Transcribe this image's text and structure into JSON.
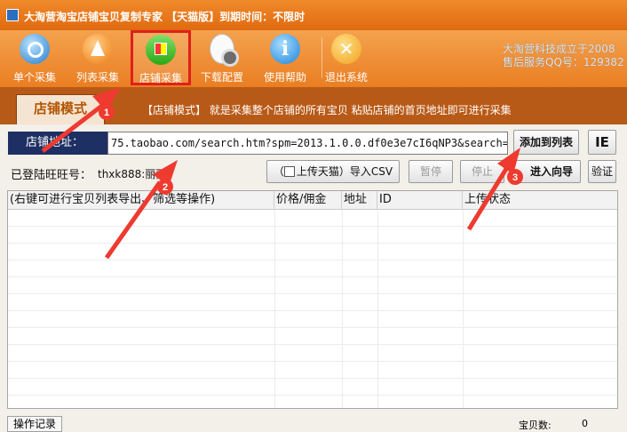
{
  "window": {
    "title": "大淘营淘宝店铺宝贝复制专家 【天猫版】到期时间：不限时"
  },
  "toolbar": {
    "buttons": [
      {
        "label": "单个采集",
        "icon": "magnifier-icon"
      },
      {
        "label": "列表采集",
        "icon": "triangle-a-icon"
      },
      {
        "label": "店铺采集",
        "icon": "shop-icon",
        "active": true
      },
      {
        "label": "下载配置",
        "icon": "document-gear-icon"
      },
      {
        "label": "使用帮助",
        "icon": "info-icon"
      },
      {
        "label": "退出系统",
        "icon": "exit-x-icon"
      }
    ]
  },
  "company": {
    "line1": "大淘营科技成立于2008",
    "line2": "售后服务QQ号：129382"
  },
  "mode": {
    "tab_label": "店铺模式",
    "description": "【店铺模式】 就是采集整个店铺的所有宝贝  粘贴店铺的首页地址即可进行采集"
  },
  "url_bar": {
    "label": "店铺地址：",
    "value": "75.taobao.com/search.htm?spm=2013.1.0.0.df0e3e7cI6qNP3&search=y",
    "add_button": "添加到列表",
    "ie_button": "IE"
  },
  "actions": {
    "login_label": "已登陆旺旺号：",
    "login_user": "thxk888:丽丽",
    "upload_tmall_label": "上传天猫",
    "upload_tmall_checked": false,
    "upload_prefix": "（",
    "upload_suffix": "）导入CSV",
    "pause": "暂停",
    "stop": "停止",
    "wizard": "进入向导",
    "verify": "验证"
  },
  "table": {
    "columns": [
      "(右键可进行宝贝列表导出、筛选等操作)",
      "价格/佣金",
      "地址",
      "ID",
      "上传状态"
    ]
  },
  "status": {
    "log_button": "操作记录",
    "count_label": "宝贝数:",
    "count": "0"
  },
  "annotations": {
    "color": "#ee3a2f",
    "markers": [
      "1",
      "2",
      "3"
    ]
  }
}
